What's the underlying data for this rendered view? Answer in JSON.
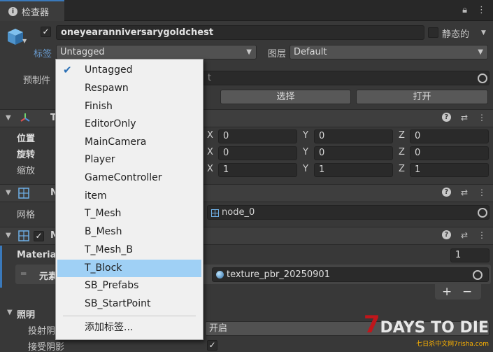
{
  "tab": {
    "title": "检查器"
  },
  "object": {
    "name": "oneyearanniversarygoldchest",
    "static_label": "静态的",
    "tag_label": "标签",
    "tag_value": "Untagged",
    "layer_label": "图层",
    "layer_value": "Default",
    "prefab_label": "预制件",
    "prefab_value_fragment": "t",
    "select_button": "选择",
    "open_button": "打开"
  },
  "transform": {
    "header_fragment": "T",
    "position_label": "位置",
    "rotation_label": "旋转",
    "scale_label": "缩放",
    "position": {
      "x": "0",
      "y": "0",
      "z": "0"
    },
    "rotation": {
      "x": "0",
      "y": "0",
      "z": "0"
    },
    "scale": {
      "x": "1",
      "y": "1",
      "z": "1"
    },
    "axis_x": "X",
    "axis_y": "Y",
    "axis_z": "Z"
  },
  "mesh_filter": {
    "header_fragment": "N",
    "mesh_label": "网格",
    "mesh_value": "node_0"
  },
  "mesh_renderer": {
    "header_fragment": "M",
    "materials_label": "Materia",
    "materials_count": "1",
    "element_label": "元素",
    "element_value": "texture_pbr_20250901",
    "add_button": "+",
    "remove_button": "−"
  },
  "lighting": {
    "label": "照明",
    "cast_shadows_label": "投射阴",
    "cast_shadows_value": "开启",
    "receive_shadows_label": "接受阴影"
  },
  "tag_menu": {
    "items": [
      "Untagged",
      "Respawn",
      "Finish",
      "EditorOnly",
      "MainCamera",
      "Player",
      "GameController",
      "item",
      "T_Mesh",
      "B_Mesh",
      "T_Mesh_B",
      "T_Block",
      "SB_Prefabs",
      "SB_StartPoint"
    ],
    "checked": "Untagged",
    "highlighted": "T_Block",
    "add_tag": "添加标签..."
  },
  "watermark": {
    "main": "DAYS TO DIE",
    "digit": "7",
    "sub": "七日杀中文网7risha.com"
  },
  "colors": {
    "accent": "#3a79bb",
    "highlight": "#9fd0f5",
    "menu_bg": "#f0f0f0",
    "panel_bg": "#383838"
  },
  "icons": [
    "info-icon",
    "lock-icon",
    "menu-dots-icon",
    "cube-icon",
    "transform-icon",
    "mesh-grid-icon",
    "help-icon",
    "settings-sliders-icon",
    "target-icon",
    "check-icon"
  ]
}
